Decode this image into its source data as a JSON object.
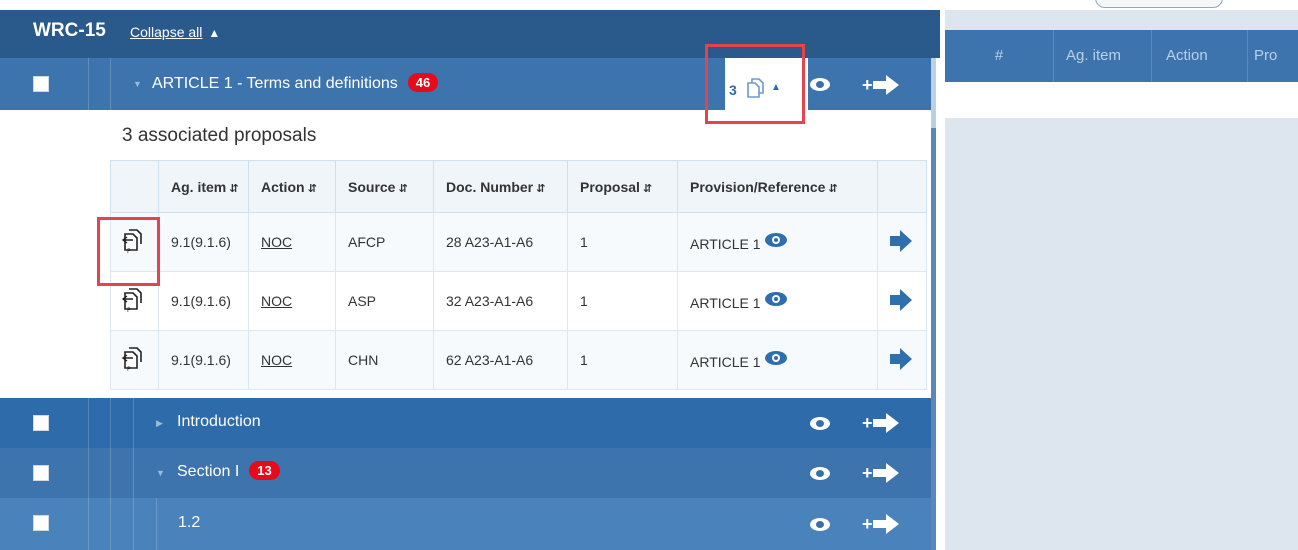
{
  "header": {
    "title": "WRC-15",
    "collapse_label": "Collapse all",
    "collapse_icon": "double-chevron-up"
  },
  "article_row": {
    "label": "ARTICLE 1 - Terms and definitions",
    "badge": "46",
    "proposals_count": "3"
  },
  "associated": {
    "title": "3 associated proposals",
    "columns": [
      "Ag. item",
      "Action",
      "Source",
      "Doc. Number",
      "Proposal",
      "Provision/Reference"
    ],
    "rows": [
      {
        "ag_item": "9.1(9.1.6)",
        "action": "NOC",
        "source": "AFCP",
        "doc": "28 A23-A1-A6",
        "proposal": "1",
        "provision": "ARTICLE 1"
      },
      {
        "ag_item": "9.1(9.1.6)",
        "action": "NOC",
        "source": "ASP",
        "doc": "32 A23-A1-A6",
        "proposal": "1",
        "provision": "ARTICLE 1"
      },
      {
        "ag_item": "9.1(9.1.6)",
        "action": "NOC",
        "source": "CHN",
        "doc": "62 A23-A1-A6",
        "proposal": "1",
        "provision": "ARTICLE 1"
      }
    ]
  },
  "tree_rows": [
    {
      "label": "Introduction",
      "badge": ""
    },
    {
      "label": "Section I",
      "badge": "13"
    },
    {
      "label": "1.2",
      "badge": ""
    }
  ],
  "right_panel": {
    "columns": [
      "#",
      "Ag. item",
      "Action",
      "Pro"
    ]
  },
  "colors": {
    "header_bg": "#2a5a8c",
    "row_bg": "#3e74ad",
    "badge_red": "#e8091a",
    "highlight_red": "#e4444c",
    "accent_blue": "#2f6fae"
  }
}
